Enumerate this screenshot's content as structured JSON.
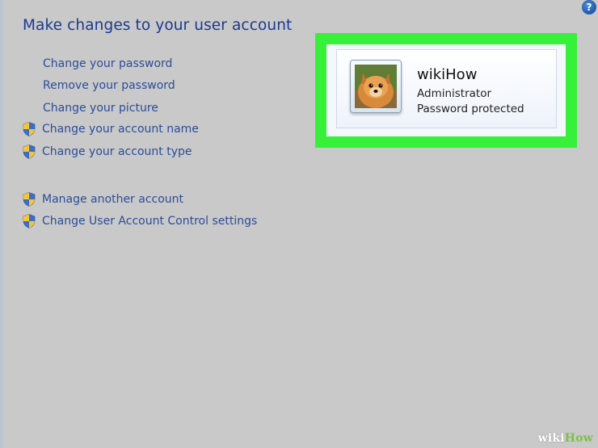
{
  "header": {
    "help_icon": "help-icon",
    "help_glyph": "?",
    "title": "Make changes to your user account"
  },
  "tasks": {
    "plain": [
      {
        "label": "Change your password"
      },
      {
        "label": "Remove your password"
      },
      {
        "label": "Change your picture"
      }
    ],
    "shielded": [
      {
        "label": "Change your account name",
        "icon": "uac-shield-icon"
      },
      {
        "label": "Change your account type",
        "icon": "uac-shield-icon"
      }
    ],
    "other": [
      {
        "label": "Manage another account",
        "icon": "uac-shield-icon"
      },
      {
        "label": "Change User Account Control settings",
        "icon": "uac-shield-icon"
      }
    ]
  },
  "account": {
    "name": "wikiHow",
    "role": "Administrator",
    "status": "Password protected",
    "picture_icon": "dog-avatar"
  },
  "highlight_color": "#36f03a",
  "link_color": "#2a4d9a",
  "title_color": "#1a3a8f",
  "watermark": {
    "part1": "wiki",
    "part2": "How"
  }
}
